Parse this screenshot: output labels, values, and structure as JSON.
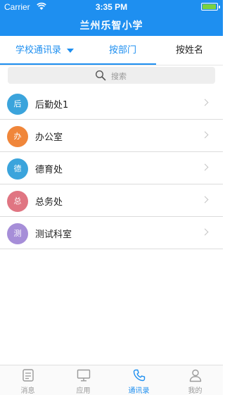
{
  "status_bar": {
    "carrier": "Carrier",
    "time": "3:35 PM"
  },
  "header": {
    "title": "兰州乐智小学"
  },
  "tabs": {
    "school_dropdown": "学校通讯录",
    "by_department": "按部门",
    "by_name": "按姓名"
  },
  "search": {
    "placeholder": "搜索"
  },
  "departments": [
    {
      "avatar": "后",
      "label": "后勤处1",
      "color": "#3ba4dc"
    },
    {
      "avatar": "办",
      "label": "办公室",
      "color": "#f0863a"
    },
    {
      "avatar": "德",
      "label": "德育处",
      "color": "#3ba4dc"
    },
    {
      "avatar": "总",
      "label": "总务处",
      "color": "#e07582"
    },
    {
      "avatar": "测",
      "label": "测试科室",
      "color": "#a68ed8"
    }
  ],
  "tabbar": {
    "items": [
      {
        "label": "消息",
        "icon": "message-icon"
      },
      {
        "label": "应用",
        "icon": "monitor-icon"
      },
      {
        "label": "通讯录",
        "icon": "phone-icon",
        "active": true
      },
      {
        "label": "我的",
        "icon": "user-icon"
      }
    ]
  },
  "colors": {
    "accent": "#1e8ff0",
    "battery": "#7bd23f"
  }
}
